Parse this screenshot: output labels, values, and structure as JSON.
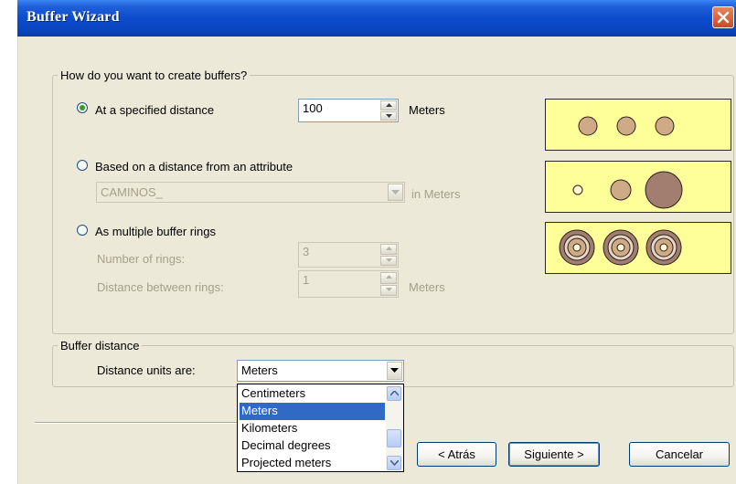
{
  "window": {
    "title": "Buffer Wizard"
  },
  "create_group": {
    "legend": "How do you want to create buffers?",
    "option_specified_distance": {
      "label": "At a specified distance",
      "value": "100",
      "unit": "Meters",
      "selected": true
    },
    "option_attribute": {
      "label": "Based on a distance from an attribute",
      "field": "CAMINOS_",
      "unit": "in Meters",
      "selected": false
    },
    "option_rings": {
      "label": "As multiple buffer rings",
      "selected": false,
      "rings_label": "Number of rings:",
      "rings_value": "3",
      "distance_label": "Distance between rings:",
      "distance_value": "1",
      "distance_unit": "Meters"
    }
  },
  "distance_group": {
    "legend": "Buffer distance",
    "units_label": "Distance units are:",
    "units_value": "Meters",
    "units_options": [
      "Centimeters",
      "Meters",
      "Kilometers",
      "Decimal degrees",
      "Projected meters"
    ],
    "selected_option": "Meters"
  },
  "buttons": {
    "back": "< Atrás",
    "next": "Siguiente >",
    "cancel": "Cancelar"
  },
  "colors": {
    "preview_bg": "#ffff99",
    "circle_fill": "#cfaa86",
    "circle_dark": "#a17e70",
    "title_bar": "#0d4ccc",
    "close_button": "#d6572f",
    "selection": "#316ac5"
  },
  "icons": {
    "close": "close-icon",
    "spin_up": "arrow-up-icon",
    "spin_down": "arrow-down-icon",
    "combo": "chevron-down-icon"
  }
}
